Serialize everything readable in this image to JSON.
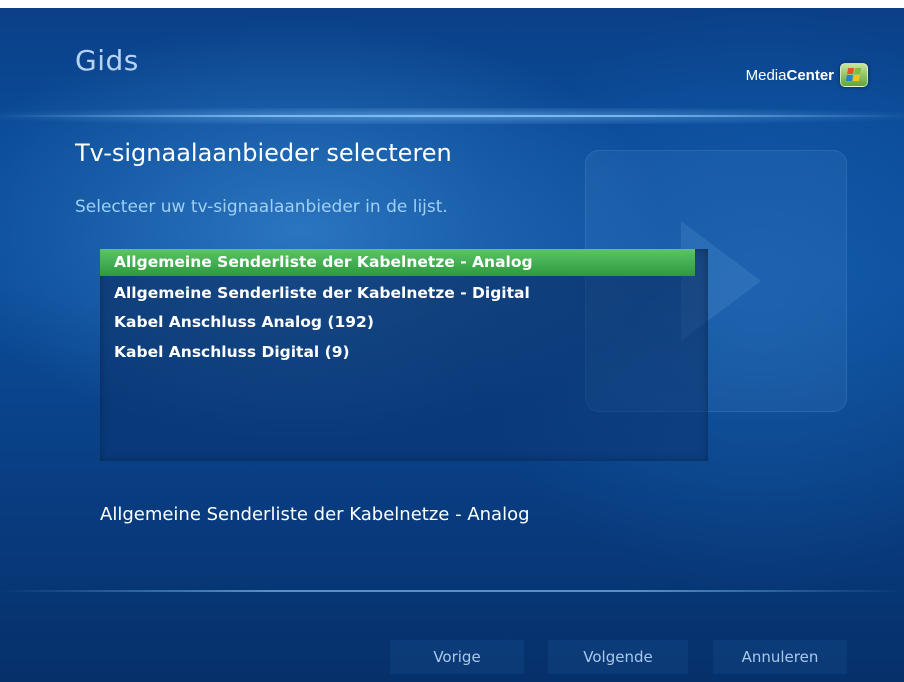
{
  "header": {
    "page_heading": "Gids",
    "brand": {
      "media": "Media",
      "center": "Center"
    }
  },
  "main": {
    "title": "Tv-signaalaanbieder selecteren",
    "subtitle": "Selecteer uw tv-signaalaanbieder in de lijst.",
    "providers": [
      "Allgemeine Senderliste der Kabelnetze - Analog",
      "Allgemeine Senderliste der Kabelnetze - Digital",
      "Kabel Anschluss Analog (192)",
      "Kabel Anschluss Digital (9)"
    ],
    "selected_index": 0,
    "selected_caption": "Allgemeine Senderliste der Kabelnetze - Analog"
  },
  "footer": {
    "prev_label": "Vorige",
    "next_label": "Volgende",
    "cancel_label": "Annuleren"
  },
  "colors": {
    "background": "#0a4a97",
    "selection": "#3aa848",
    "subtitle": "#9fd0f5"
  }
}
